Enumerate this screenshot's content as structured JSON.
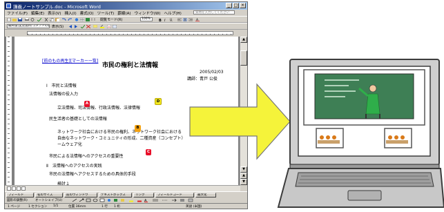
{
  "window": {
    "title": "講義ノートサンプル.doc - Microsoft Word",
    "help_placeholder": "質問を入力してください",
    "controls": [
      "_",
      "□",
      "×"
    ]
  },
  "menu": [
    "ファイル(F)",
    "編集(E)",
    "表示(V)",
    "挿入(I)",
    "書式(O)",
    "ツール(T)",
    "罫線(A)",
    "ウィンドウ(W)",
    "ヘルプ(H)"
  ],
  "toolbar": {
    "zoom": "100%",
    "view_mode": "閲覧モード(R)",
    "style_box": "本文",
    "changes_box": "最終版(変更箇所/コメントの表示)",
    "show_label": "表示(S)"
  },
  "document": {
    "links": [
      "[前のもの再生]",
      "[マーカー一覧]"
    ],
    "title": "市民の権利と法情報",
    "date": "2005/02/03",
    "author": "講師：青戸 公俊",
    "lines": [
      "Ⅰ　市民と法情報",
      "法情報の役入力",
      "立法情報、司法情報、行政法情報、法律情報",
      "民生活者の基礎としての法情報",
      "ネットワーク社会における市民の権利、ネットワーク社会における",
      "自由なネットワーク・コミュニティの形成、二種資産（コンセプト）",
      "ームウェア化",
      "市民による法情報へのアクセスの重要性",
      "Ⅱ　法情報へのアクセスの実践",
      "市民の法情報へアクセスするための具体的手段",
      "検討１"
    ],
    "markers": [
      "A",
      "D",
      "B",
      "C"
    ]
  },
  "taskbar_buttons": [
    "フィールド",
    "名のサイズ",
    "前のウィンドウ",
    "テキストボックス",
    "リンク",
    "フィールドコード",
    "最大化"
  ],
  "drawbar": {
    "draw_label": "図形の調整(R)",
    "autoshape_label": "オートシェイプ(U)"
  },
  "status": {
    "page": "1 ページ",
    "section": "1 セクション",
    "pages": "1/1",
    "position": "位置 36mm",
    "line": "1 行",
    "column": "1 桁",
    "mode": "英語 (米国)"
  },
  "colors": {
    "titlebar_start": "#0a246a",
    "titlebar_end": "#a6caf0",
    "arrow": "#f5f33a",
    "marker_red": "#e8102a",
    "marker_orange": "#f4a10f",
    "marker_yellow": "#f3e920",
    "slide_green": "#3e7f55"
  }
}
